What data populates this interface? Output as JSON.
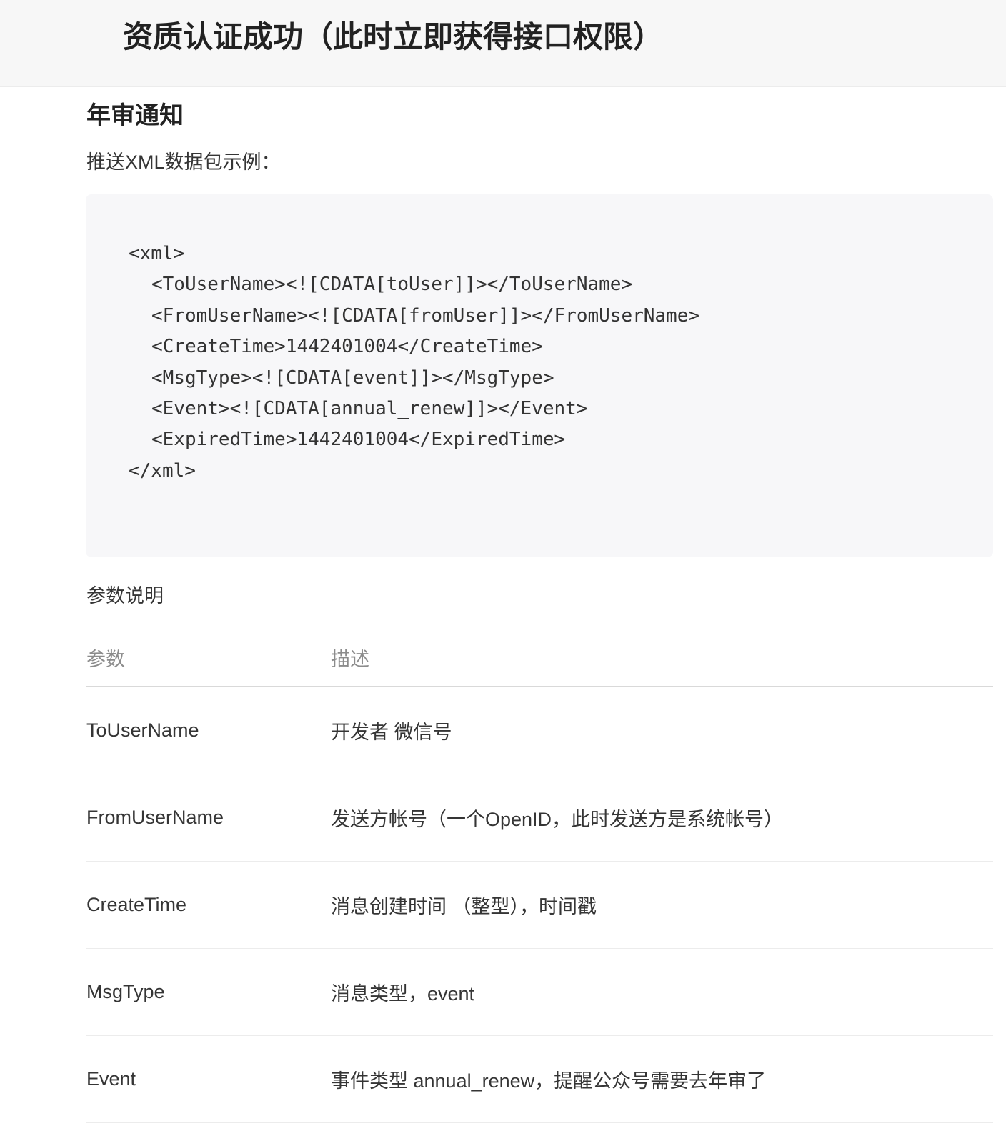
{
  "header": {
    "title": "资质认证成功（此时立即获得接口权限）"
  },
  "section": {
    "title": "年审通知",
    "sample_label": "推送XML数据包示例：",
    "code_lines": [
      "<xml>",
      "<ToUserName><![CDATA[toUser]]></ToUserName>",
      "<FromUserName><![CDATA[fromUser]]></FromUserName>",
      "<CreateTime>1442401004</CreateTime>",
      "<MsgType><![CDATA[event]]></MsgType>",
      "<Event><![CDATA[annual_renew]]></Event>",
      "<ExpiredTime>1442401004</ExpiredTime>",
      "</xml>"
    ],
    "param_heading": "参数说明"
  },
  "table": {
    "headers": [
      "参数",
      "描述"
    ],
    "rows": [
      {
        "param": "ToUserName",
        "desc": "开发者 微信号"
      },
      {
        "param": "FromUserName",
        "desc": "发送方帐号（一个OpenID，此时发送方是系统帐号）"
      },
      {
        "param": "CreateTime",
        "desc": "消息创建时间 （整型），时间戳"
      },
      {
        "param": "MsgType",
        "desc": "消息类型，event"
      },
      {
        "param": "Event",
        "desc": "事件类型 annual_renew，提醒公众号需要去年审了"
      }
    ]
  }
}
